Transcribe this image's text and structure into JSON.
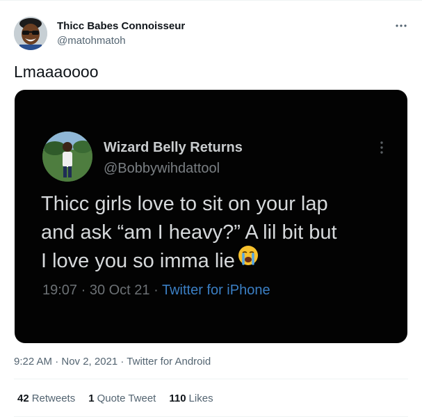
{
  "tweet": {
    "author": {
      "name": "Thicc Babes Connoisseur",
      "handle": "@matohmatoh",
      "avatar_icon": "avatar-person-sunglasses"
    },
    "text": "Lmaaaoooo",
    "more_icon": "more-horizontal-icon",
    "timestamp": "9:22 AM · Nov 2, 2021 · Twitter for Android",
    "stats": {
      "retweets": {
        "count": "42",
        "label": "Retweets"
      },
      "quote_tweets": {
        "count": "1",
        "label": "Quote Tweet"
      },
      "likes": {
        "count": "110",
        "label": "Likes"
      }
    }
  },
  "media_screenshot": {
    "name": "Wizard Belly Returns",
    "handle": "@Bobbywihdattool",
    "text_lines": [
      "Thicc girls love to sit on your lap",
      "and ask “am I heavy?” A lil bit but",
      "I love you so imma lie"
    ],
    "emoji": "loudly-crying-face",
    "time": "19:07 · 30 Oct 21 · ",
    "client": "Twitter for iPhone",
    "colors": {
      "background": "#030303",
      "link": "#3b7fc4"
    }
  }
}
